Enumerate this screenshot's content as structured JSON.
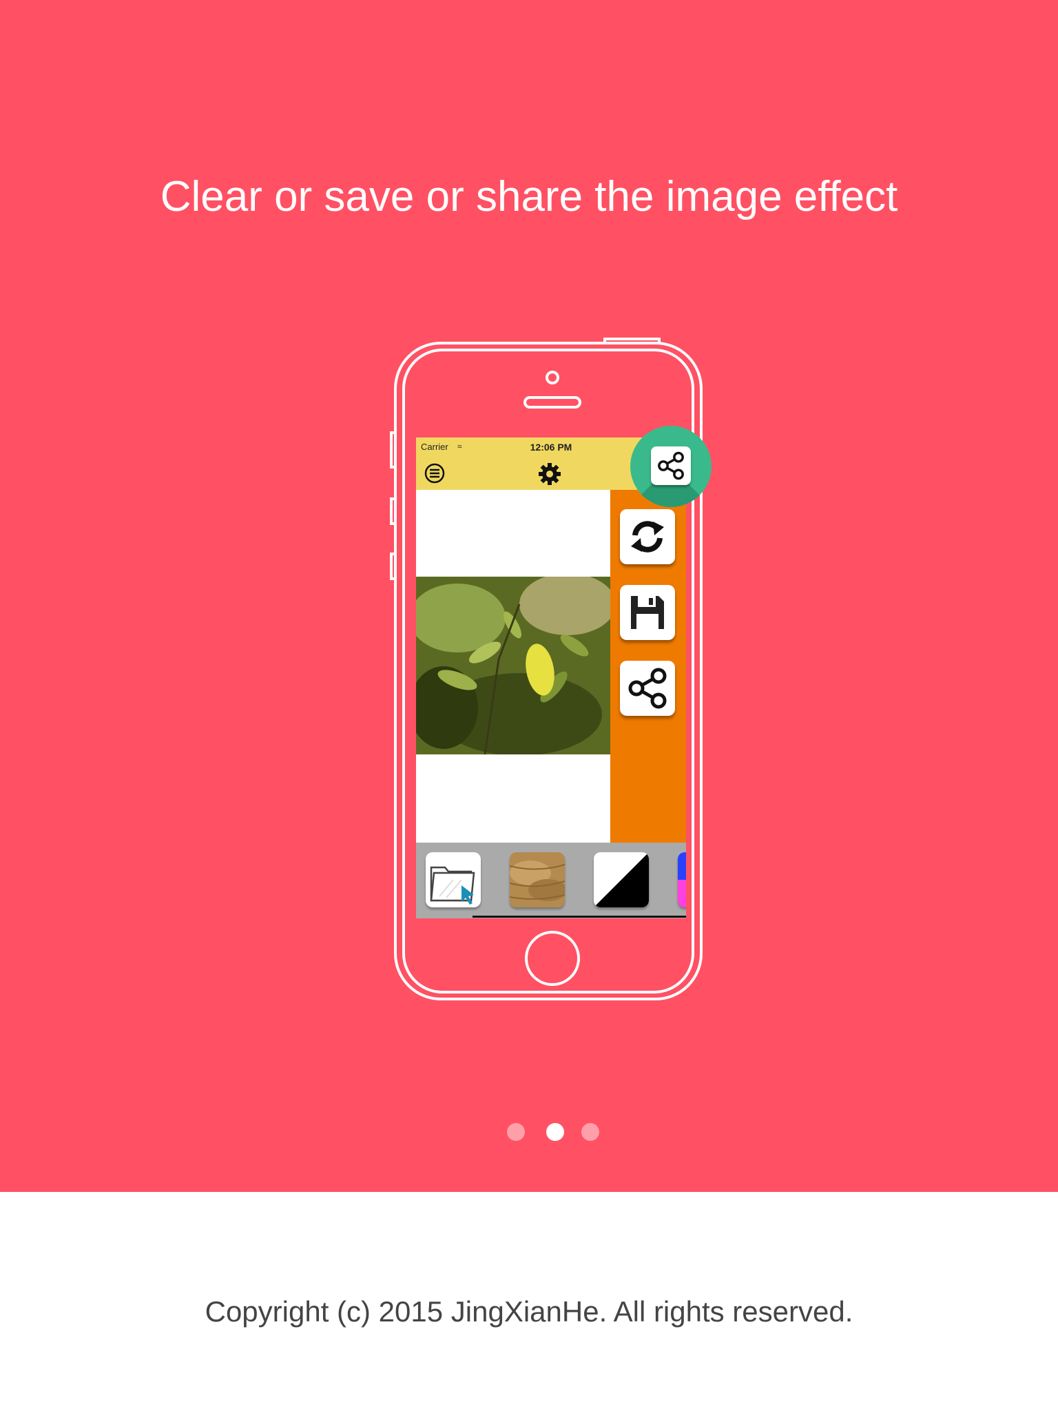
{
  "headline": "Clear or save or share the image effect",
  "copyright": "Copyright (c) 2015 JingXianHe. All rights reserved.",
  "colors": {
    "background": "#ff5163",
    "status_bar": "#f0d860",
    "side_panel": "#ef7a00",
    "fab": "#3aba8c",
    "footer_background": "#ffffff"
  },
  "phone": {
    "status_bar": {
      "carrier": "Carrier",
      "time": "12:06 PM"
    },
    "toolbar": {
      "icons": [
        "menu-icon",
        "gear-icon"
      ]
    },
    "side_tools": [
      {
        "name": "refresh-icon"
      },
      {
        "name": "save-icon"
      },
      {
        "name": "share-icon"
      }
    ],
    "fab_icon": "share-icon",
    "thumbnails": [
      "open-folder-icon",
      "texture-thumbnail",
      "black-white-thumbnail",
      "color-thumbnail"
    ]
  },
  "pagination": {
    "total": 3,
    "active_index": 1
  }
}
